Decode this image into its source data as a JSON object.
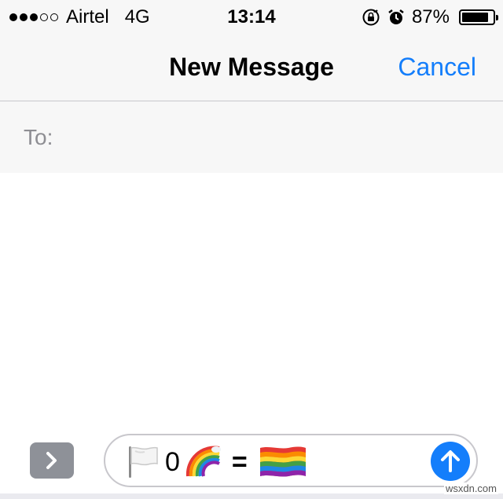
{
  "status_bar": {
    "signal_full": 3,
    "signal_total": 5,
    "carrier": "Airtel",
    "network": "4G",
    "time": "13:14",
    "battery_percent": "87%",
    "battery_level": 0.87,
    "icons": [
      "orientation-lock-icon",
      "alarm-icon",
      "battery-icon"
    ]
  },
  "nav": {
    "title": "New Message",
    "cancel_label": "Cancel",
    "accent_color": "#147efb"
  },
  "recipient": {
    "label": "To:",
    "value": ""
  },
  "compose": {
    "icons": [
      "white-flag-icon",
      "rainbow-icon",
      "rainbow-flag-icon"
    ],
    "digit": "0",
    "equals": "=",
    "expand_icon": "chevron-right-icon",
    "send_icon": "arrow-up-icon"
  },
  "watermark": "wsxdn.com"
}
